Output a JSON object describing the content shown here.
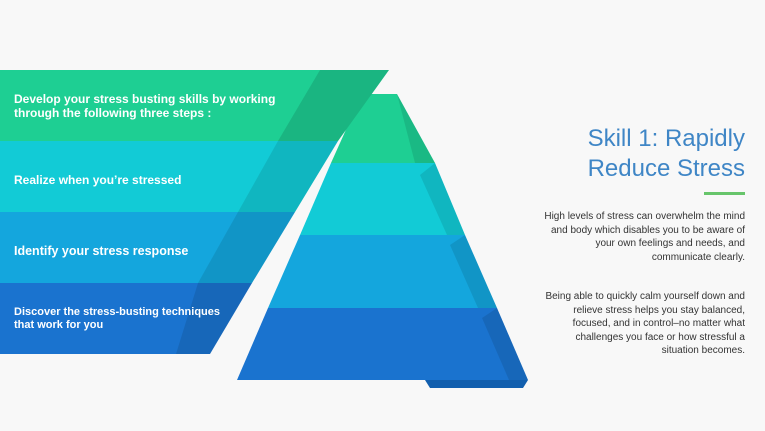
{
  "colors": {
    "background": "#f8f8f8",
    "band_1": "#1ecf93",
    "band_2": "#12cbd6",
    "band_3": "#14a6dd",
    "band_4": "#1a73cf",
    "title": "#3f86c6",
    "underline": "#67c56b",
    "body_text": "#333333"
  },
  "diagram": {
    "type": "pyramid",
    "levels": [
      {
        "label": "Develop your stress busting skills by working through the following three steps :"
      },
      {
        "label": "Realize when you’re stressed"
      },
      {
        "label": "Identify your stress response"
      },
      {
        "label": "Discover the stress-busting techniques that work for you"
      }
    ]
  },
  "sidebar": {
    "title": "Skill 1: Rapidly Reduce Stress",
    "paragraphs": [
      "High levels of stress can overwhelm the mind and body which disables you to be aware of your own feelings and needs, and communicate clearly.",
      "Being able to quickly calm yourself down and relieve stress helps you stay balanced, focused, and in control–no matter what challenges you face or how stressful a situation becomes."
    ]
  }
}
